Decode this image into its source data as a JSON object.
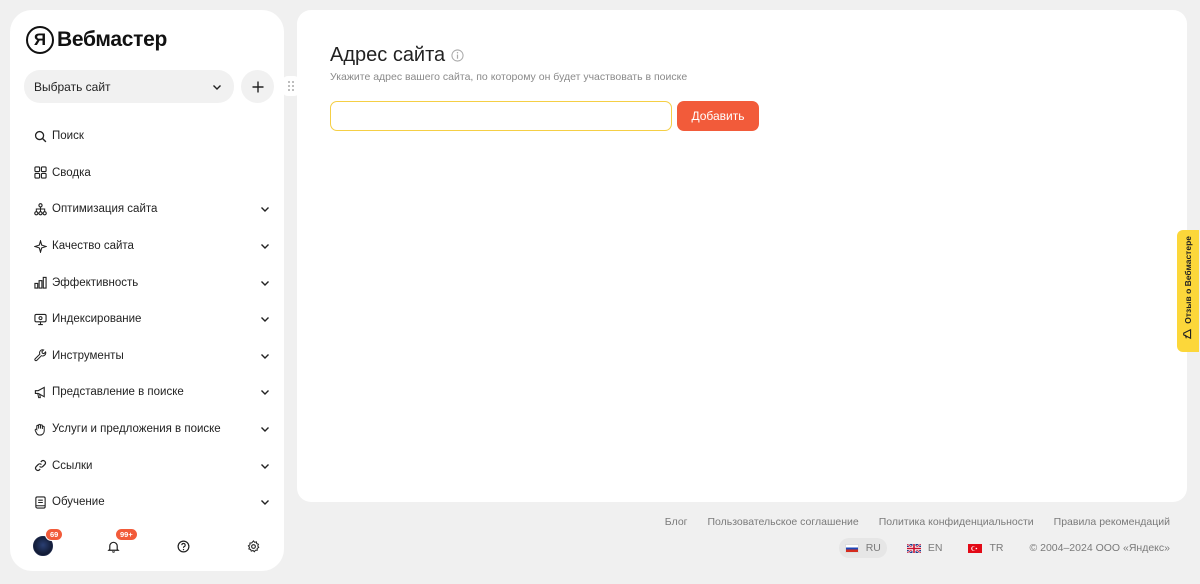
{
  "app": {
    "logo_letter": "Я",
    "logo_name": "Вебмастер"
  },
  "sidebar": {
    "site_select_label": "Выбрать сайт",
    "items": [
      {
        "label": "Поиск",
        "icon": "search-icon",
        "expandable": false
      },
      {
        "label": "Сводка",
        "icon": "dashboard-icon",
        "expandable": false
      },
      {
        "label": "Оптимизация сайта",
        "icon": "hierarchy-icon",
        "expandable": true
      },
      {
        "label": "Качество сайта",
        "icon": "sparkle-icon",
        "expandable": true
      },
      {
        "label": "Эффективность",
        "icon": "bar-chart-icon",
        "expandable": true
      },
      {
        "label": "Индексирование",
        "icon": "monitor-icon",
        "expandable": true
      },
      {
        "label": "Инструменты",
        "icon": "wrench-icon",
        "expandable": true
      },
      {
        "label": "Представление в поиске",
        "icon": "megaphone-icon",
        "expandable": true
      },
      {
        "label": "Услуги и предложения в поиске",
        "icon": "hand-icon",
        "expandable": true
      },
      {
        "label": "Ссылки",
        "icon": "link-icon",
        "expandable": true
      },
      {
        "label": "Обучение",
        "icon": "book-icon",
        "expandable": true
      }
    ],
    "bottom": {
      "avatar_badge": "69",
      "notifications_badge": "99+"
    }
  },
  "main": {
    "title": "Адрес сайта",
    "subtitle": "Укажите адрес вашего сайта, по которому он будет участвовать в поиске",
    "input_value": "",
    "add_button": "Добавить"
  },
  "feedback_tab": "Отзыв о Вебмастере",
  "footer": {
    "links": [
      "Блог",
      "Пользовательское соглашение",
      "Политика конфиденциальности",
      "Правила рекомендаций"
    ],
    "languages": [
      {
        "code": "RU",
        "active": true
      },
      {
        "code": "EN",
        "active": false
      },
      {
        "code": "TR",
        "active": false
      }
    ],
    "copyright": "© 2004–2024 ООО «Яндекс»"
  },
  "colors": {
    "accent": "#f25b3a",
    "input_focus": "#f5cf45",
    "feedback": "#fcd73a",
    "background": "#f0f0f0"
  }
}
